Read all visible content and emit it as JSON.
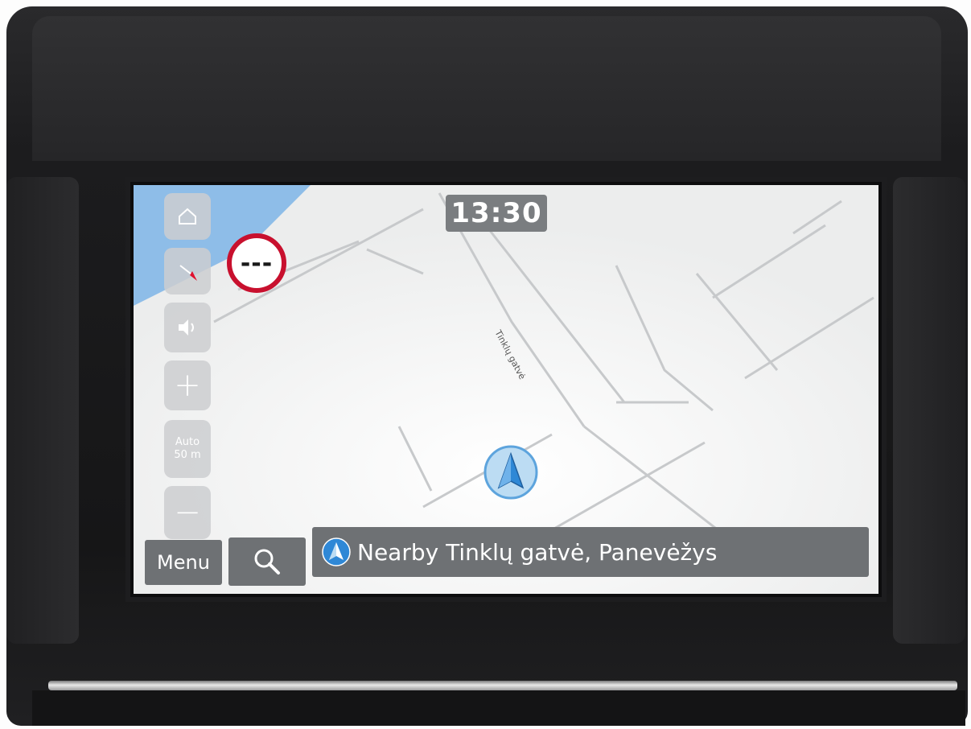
{
  "status": {
    "time": "13:30"
  },
  "map": {
    "street_label": "Tinklų gatvė",
    "speed_limit": "---",
    "zoom_mode": "Auto",
    "zoom_scale": "50 m"
  },
  "toolbar": {
    "home": "home-icon",
    "compass": "compass-icon",
    "volume": "volume-icon",
    "zoom_in": "+",
    "zoom_out": "−"
  },
  "footer": {
    "menu_label": "Menu",
    "location_text": "Nearby Tinklų gatvė, Panevėžys"
  },
  "colors": {
    "accent": "#2f88d6",
    "speed_ring": "#c8102e",
    "panel": "#6e7174",
    "map_bg": "#f3f4f4"
  }
}
